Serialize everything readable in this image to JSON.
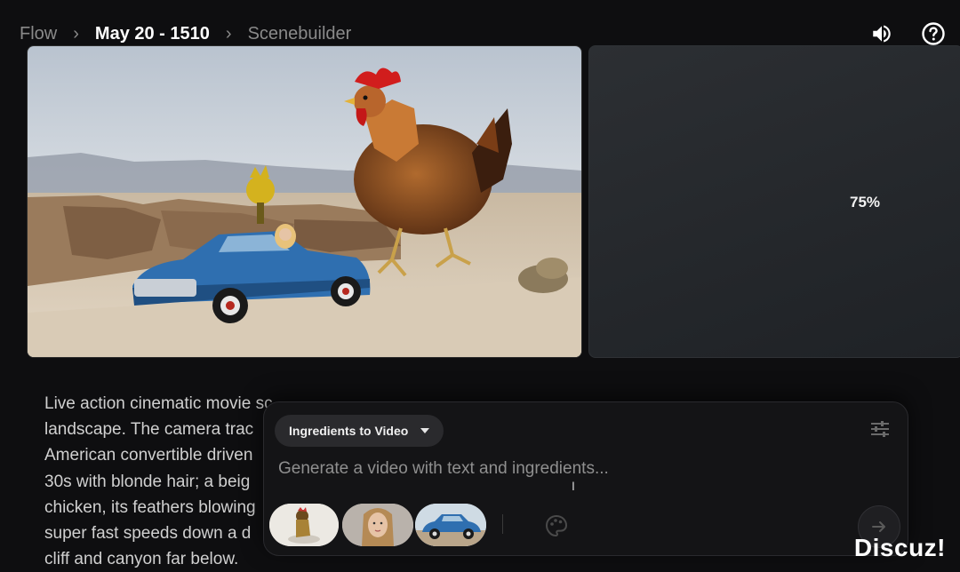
{
  "breadcrumb": {
    "root": "Flow",
    "project": "May 20 - 1510",
    "current": "Scenebuilder"
  },
  "icons": {
    "sound": "volume-icon",
    "help": "help-icon",
    "tune": "tune-icon",
    "palette": "palette-icon",
    "send": "arrow-right-icon"
  },
  "clips": {
    "generating_progress": "75%"
  },
  "prompt_text": "Live action cinematic movie sc... landscape. The camera trac... American convertible driven... 30s with blonde hair; a beig... chicken, its feathers blowing... super fast speeds down a d... cliff and canyon far below.",
  "prompt_lines": [
    "Live action cinematic movie sc",
    "landscape. The camera trac",
    "American convertible driven",
    "30s with blonde hair; a beig",
    "chicken, its feathers blowing",
    "super fast speeds down a d",
    "cliff and canyon far below."
  ],
  "composer": {
    "mode_label": "Ingredients to Video",
    "placeholder": "Generate a video with text and ingredients..."
  },
  "ingredients": [
    "rooster-ingredient",
    "woman-portrait-ingredient",
    "blue-car-ingredient"
  ],
  "watermark": "Discuz!",
  "colors": {
    "background": "#0e0e10",
    "panel": "#141416",
    "car_blue": "#2f6fb0"
  }
}
